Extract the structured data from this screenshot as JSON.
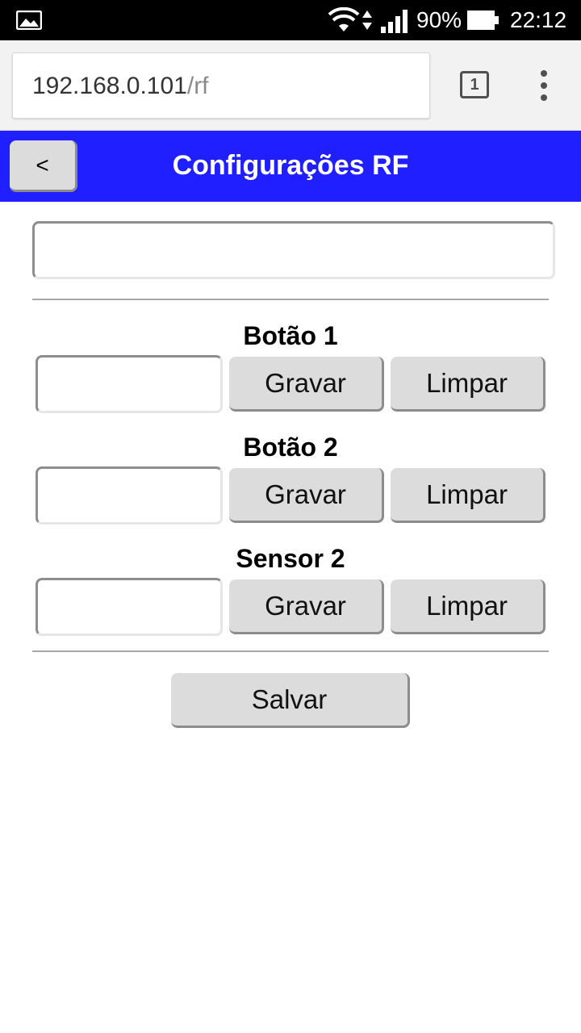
{
  "status_bar": {
    "battery_percent": "90%",
    "time": "22:12",
    "icons": [
      "gallery-icon",
      "wifi-icon",
      "data-arrows-icon",
      "signal-icon",
      "battery-icon"
    ]
  },
  "browser": {
    "url_host": "192.168.0.101",
    "url_path": "/rf",
    "tab_count": "1",
    "icons": [
      "tab-switcher-icon",
      "overflow-menu-icon"
    ]
  },
  "header": {
    "back_label": "<",
    "title": "Configurações RF",
    "color": "#1f1fff"
  },
  "main_input": {
    "value": "",
    "placeholder": ""
  },
  "sections": [
    {
      "label": "Botão 1",
      "value": "",
      "save_label": "Gravar",
      "clear_label": "Limpar"
    },
    {
      "label": "Botão 2",
      "value": "",
      "save_label": "Gravar",
      "clear_label": "Limpar"
    },
    {
      "label": "Sensor 2",
      "value": "",
      "save_label": "Gravar",
      "clear_label": "Limpar"
    }
  ],
  "footer": {
    "save_label": "Salvar"
  }
}
